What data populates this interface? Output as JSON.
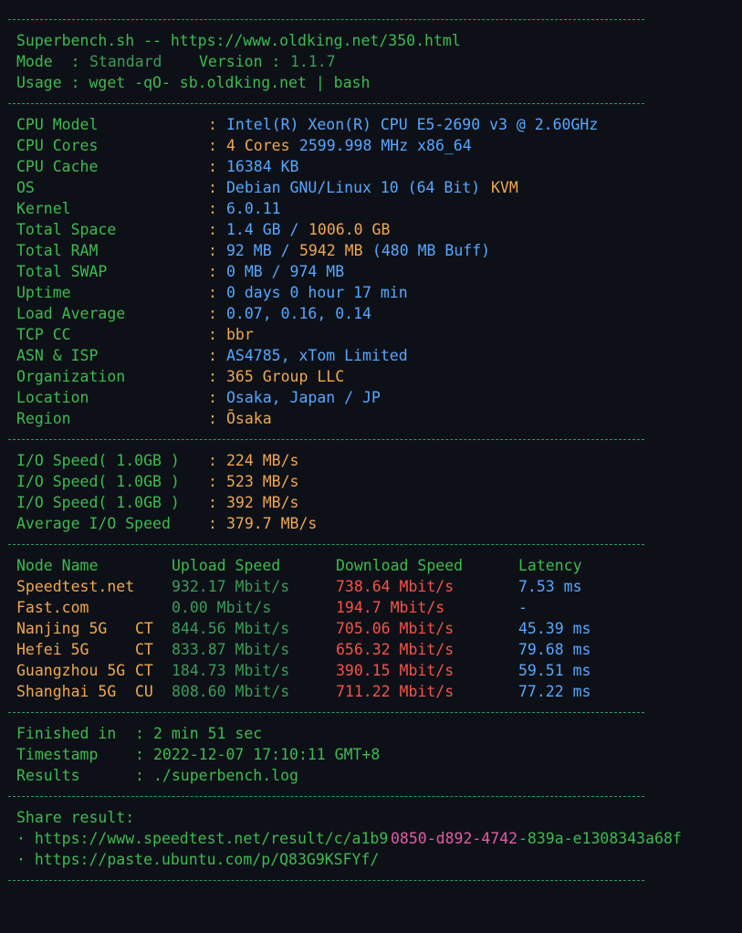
{
  "header": {
    "title_line": "Superbench.sh -- https://www.oldking.net/350.html",
    "mode_label": "Mode  : ",
    "mode_value": "Standard",
    "version_label": "Version : ",
    "version_value": "1.1.7",
    "usage_line": "Usage : wget -qO- sb.oldking.net | bash"
  },
  "system": [
    {
      "key": "CPU Model",
      "value": "Intel(R) Xeon(R) CPU E5-2690 v3 @ 2.60GHz"
    },
    {
      "key": "CPU Cores",
      "value_a": "4 Cores",
      "value_b": " 2599.998 MHz x86_64"
    },
    {
      "key": "CPU Cache",
      "value": "16384 KB"
    },
    {
      "key": "OS",
      "value_a": "Debian GNU/Linux 10 (64 Bit) ",
      "value_b": "KVM"
    },
    {
      "key": "Kernel",
      "value": "6.0.11"
    },
    {
      "key": "Total Space",
      "value_a": "1.4 GB / ",
      "value_b": "1006.0 GB"
    },
    {
      "key": "Total RAM",
      "value_a": "92 MB / ",
      "value_b": "5942 MB",
      "value_c": " (480 MB Buff)"
    },
    {
      "key": "Total SWAP",
      "value": "0 MB / 974 MB"
    },
    {
      "key": "Uptime",
      "value": "0 days 0 hour 17 min"
    },
    {
      "key": "Load Average",
      "value": "0.07, 0.16, 0.14"
    },
    {
      "key": "TCP CC",
      "value": "bbr"
    },
    {
      "key": "ASN & ISP",
      "value": "AS4785, xTom Limited"
    },
    {
      "key": "Organization",
      "value": "365 Group LLC"
    },
    {
      "key": "Location",
      "value": "Osaka, Japan / JP"
    },
    {
      "key": "Region",
      "value": "Ōsaka"
    }
  ],
  "io": [
    {
      "key": "I/O Speed( 1.0GB )",
      "value": "224 MB/s"
    },
    {
      "key": "I/O Speed( 1.0GB )",
      "value": "523 MB/s"
    },
    {
      "key": "I/O Speed( 1.0GB )",
      "value": "392 MB/s"
    },
    {
      "key": "Average I/O Speed",
      "value": "379.7 MB/s"
    }
  ],
  "colon": ": ",
  "speed": {
    "headers": [
      "Node Name",
      "Upload Speed",
      "Download Speed",
      "Latency"
    ],
    "rows": [
      {
        "node": "Speedtest.net",
        "isp": "",
        "up": "932.17 Mbit/s",
        "down": "738.64 Mbit/s",
        "lat": "7.53 ms"
      },
      {
        "node": "Fast.com",
        "isp": "",
        "up": "0.00 Mbit/s",
        "down": "194.7 Mbit/s",
        "lat": "-"
      },
      {
        "node": "Nanjing 5G",
        "isp": "CT",
        "up": "844.56 Mbit/s",
        "down": "705.06 Mbit/s",
        "lat": "45.39 ms"
      },
      {
        "node": "Hefei 5G",
        "isp": "CT",
        "up": "833.87 Mbit/s",
        "down": "656.32 Mbit/s",
        "lat": "79.68 ms"
      },
      {
        "node": "Guangzhou 5G",
        "isp": "CT",
        "up": "184.73 Mbit/s",
        "down": "390.15 Mbit/s",
        "lat": "59.51 ms"
      },
      {
        "node": "Shanghai 5G",
        "isp": "CU",
        "up": "808.60 Mbit/s",
        "down": "711.22 Mbit/s",
        "lat": "77.22 ms"
      }
    ]
  },
  "footer": [
    {
      "key": "Finished in",
      "value": "2 min 51 sec"
    },
    {
      "key": "Timestamp",
      "value": "2022-12-07 17:10:11 GMT+8"
    },
    {
      "key": "Results",
      "value": "./superbench.log"
    }
  ],
  "share": {
    "label": "Share result:",
    "link1_a": "· https://www.speedtest.net/result/c/a1b9",
    "link1_b": "0850-d892-4742",
    "link1_c": "-839a-e1308343a68f",
    "link2": "· https://paste.ubuntu.com/p/Q83G9KSFYf/"
  },
  "colors": {
    "background": "#0d1117",
    "green": "#3fb950",
    "blue": "#58a6ff",
    "orange": "#f0a652",
    "red": "#f85149",
    "pink": "#e45ba8"
  }
}
